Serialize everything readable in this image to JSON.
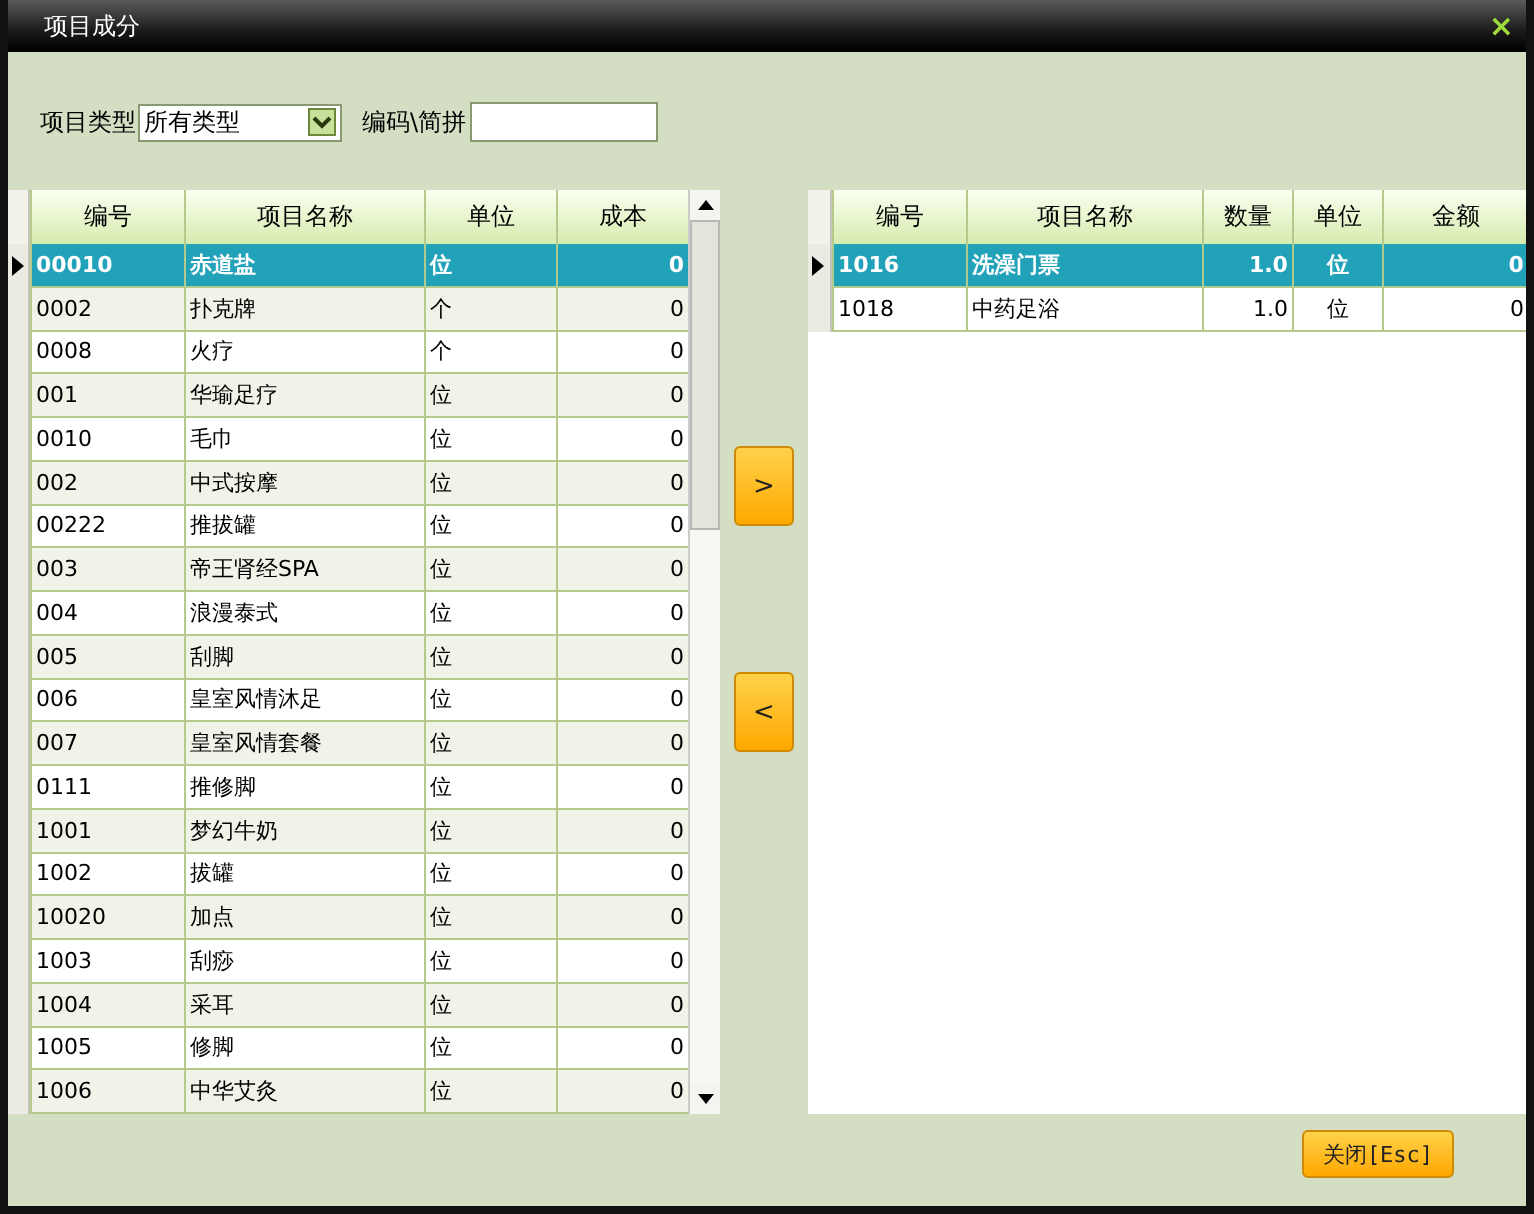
{
  "window": {
    "title": "项目成分",
    "close": "×"
  },
  "filter": {
    "type_label": "项目类型",
    "type_value": "所有类型",
    "code_label": "编码\\简拼"
  },
  "left_table": {
    "columns": [
      "编号",
      "项目名称",
      "单位",
      "成本"
    ],
    "rows": [
      {
        "cells": [
          "00010",
          "赤道盐",
          "位",
          "0"
        ],
        "selected": true
      },
      {
        "cells": [
          "0002",
          "扑克牌",
          "个",
          "0"
        ],
        "selected": false
      },
      {
        "cells": [
          "0008",
          "火疗",
          "个",
          "0"
        ],
        "selected": false
      },
      {
        "cells": [
          "001",
          "华瑜足疗",
          "位",
          "0"
        ],
        "selected": false
      },
      {
        "cells": [
          "0010",
          "毛巾",
          "位",
          "0"
        ],
        "selected": false
      },
      {
        "cells": [
          "002",
          "中式按摩",
          "位",
          "0"
        ],
        "selected": false
      },
      {
        "cells": [
          "00222",
          "推拔罐",
          "位",
          "0"
        ],
        "selected": false
      },
      {
        "cells": [
          "003",
          "帝王肾经SPA",
          "位",
          "0"
        ],
        "selected": false
      },
      {
        "cells": [
          "004",
          "浪漫泰式",
          "位",
          "0"
        ],
        "selected": false
      },
      {
        "cells": [
          "005",
          "刮脚",
          "位",
          "0"
        ],
        "selected": false
      },
      {
        "cells": [
          "006",
          "皇室风情沐足",
          "位",
          "0"
        ],
        "selected": false
      },
      {
        "cells": [
          "007",
          "皇室风情套餐",
          "位",
          "0"
        ],
        "selected": false
      },
      {
        "cells": [
          "0111",
          "推修脚",
          "位",
          "0"
        ],
        "selected": false
      },
      {
        "cells": [
          "1001",
          "梦幻牛奶",
          "位",
          "0"
        ],
        "selected": false
      },
      {
        "cells": [
          "1002",
          "拔罐",
          "位",
          "0"
        ],
        "selected": false
      },
      {
        "cells": [
          "10020",
          "加点",
          "位",
          "0"
        ],
        "selected": false
      },
      {
        "cells": [
          "1003",
          "刮痧",
          "位",
          "0"
        ],
        "selected": false
      },
      {
        "cells": [
          "1004",
          "采耳",
          "位",
          "0"
        ],
        "selected": false
      },
      {
        "cells": [
          "1005",
          "修脚",
          "位",
          "0"
        ],
        "selected": false
      },
      {
        "cells": [
          "1006",
          "中华艾灸",
          "位",
          "0"
        ],
        "selected": false
      }
    ]
  },
  "move_buttons": [
    ">",
    "<"
  ],
  "right_table": {
    "columns": [
      "编号",
      "项目名称",
      "数量",
      "单位",
      "金额"
    ],
    "rows": [
      {
        "cells": [
          "1016",
          "洗澡门票",
          "1.0",
          "位",
          "0"
        ],
        "selected": true
      },
      {
        "cells": [
          "1018",
          "中药足浴",
          "1.0",
          "位",
          "0"
        ],
        "selected": false
      }
    ]
  },
  "close_button": "关闭[Esc]"
}
